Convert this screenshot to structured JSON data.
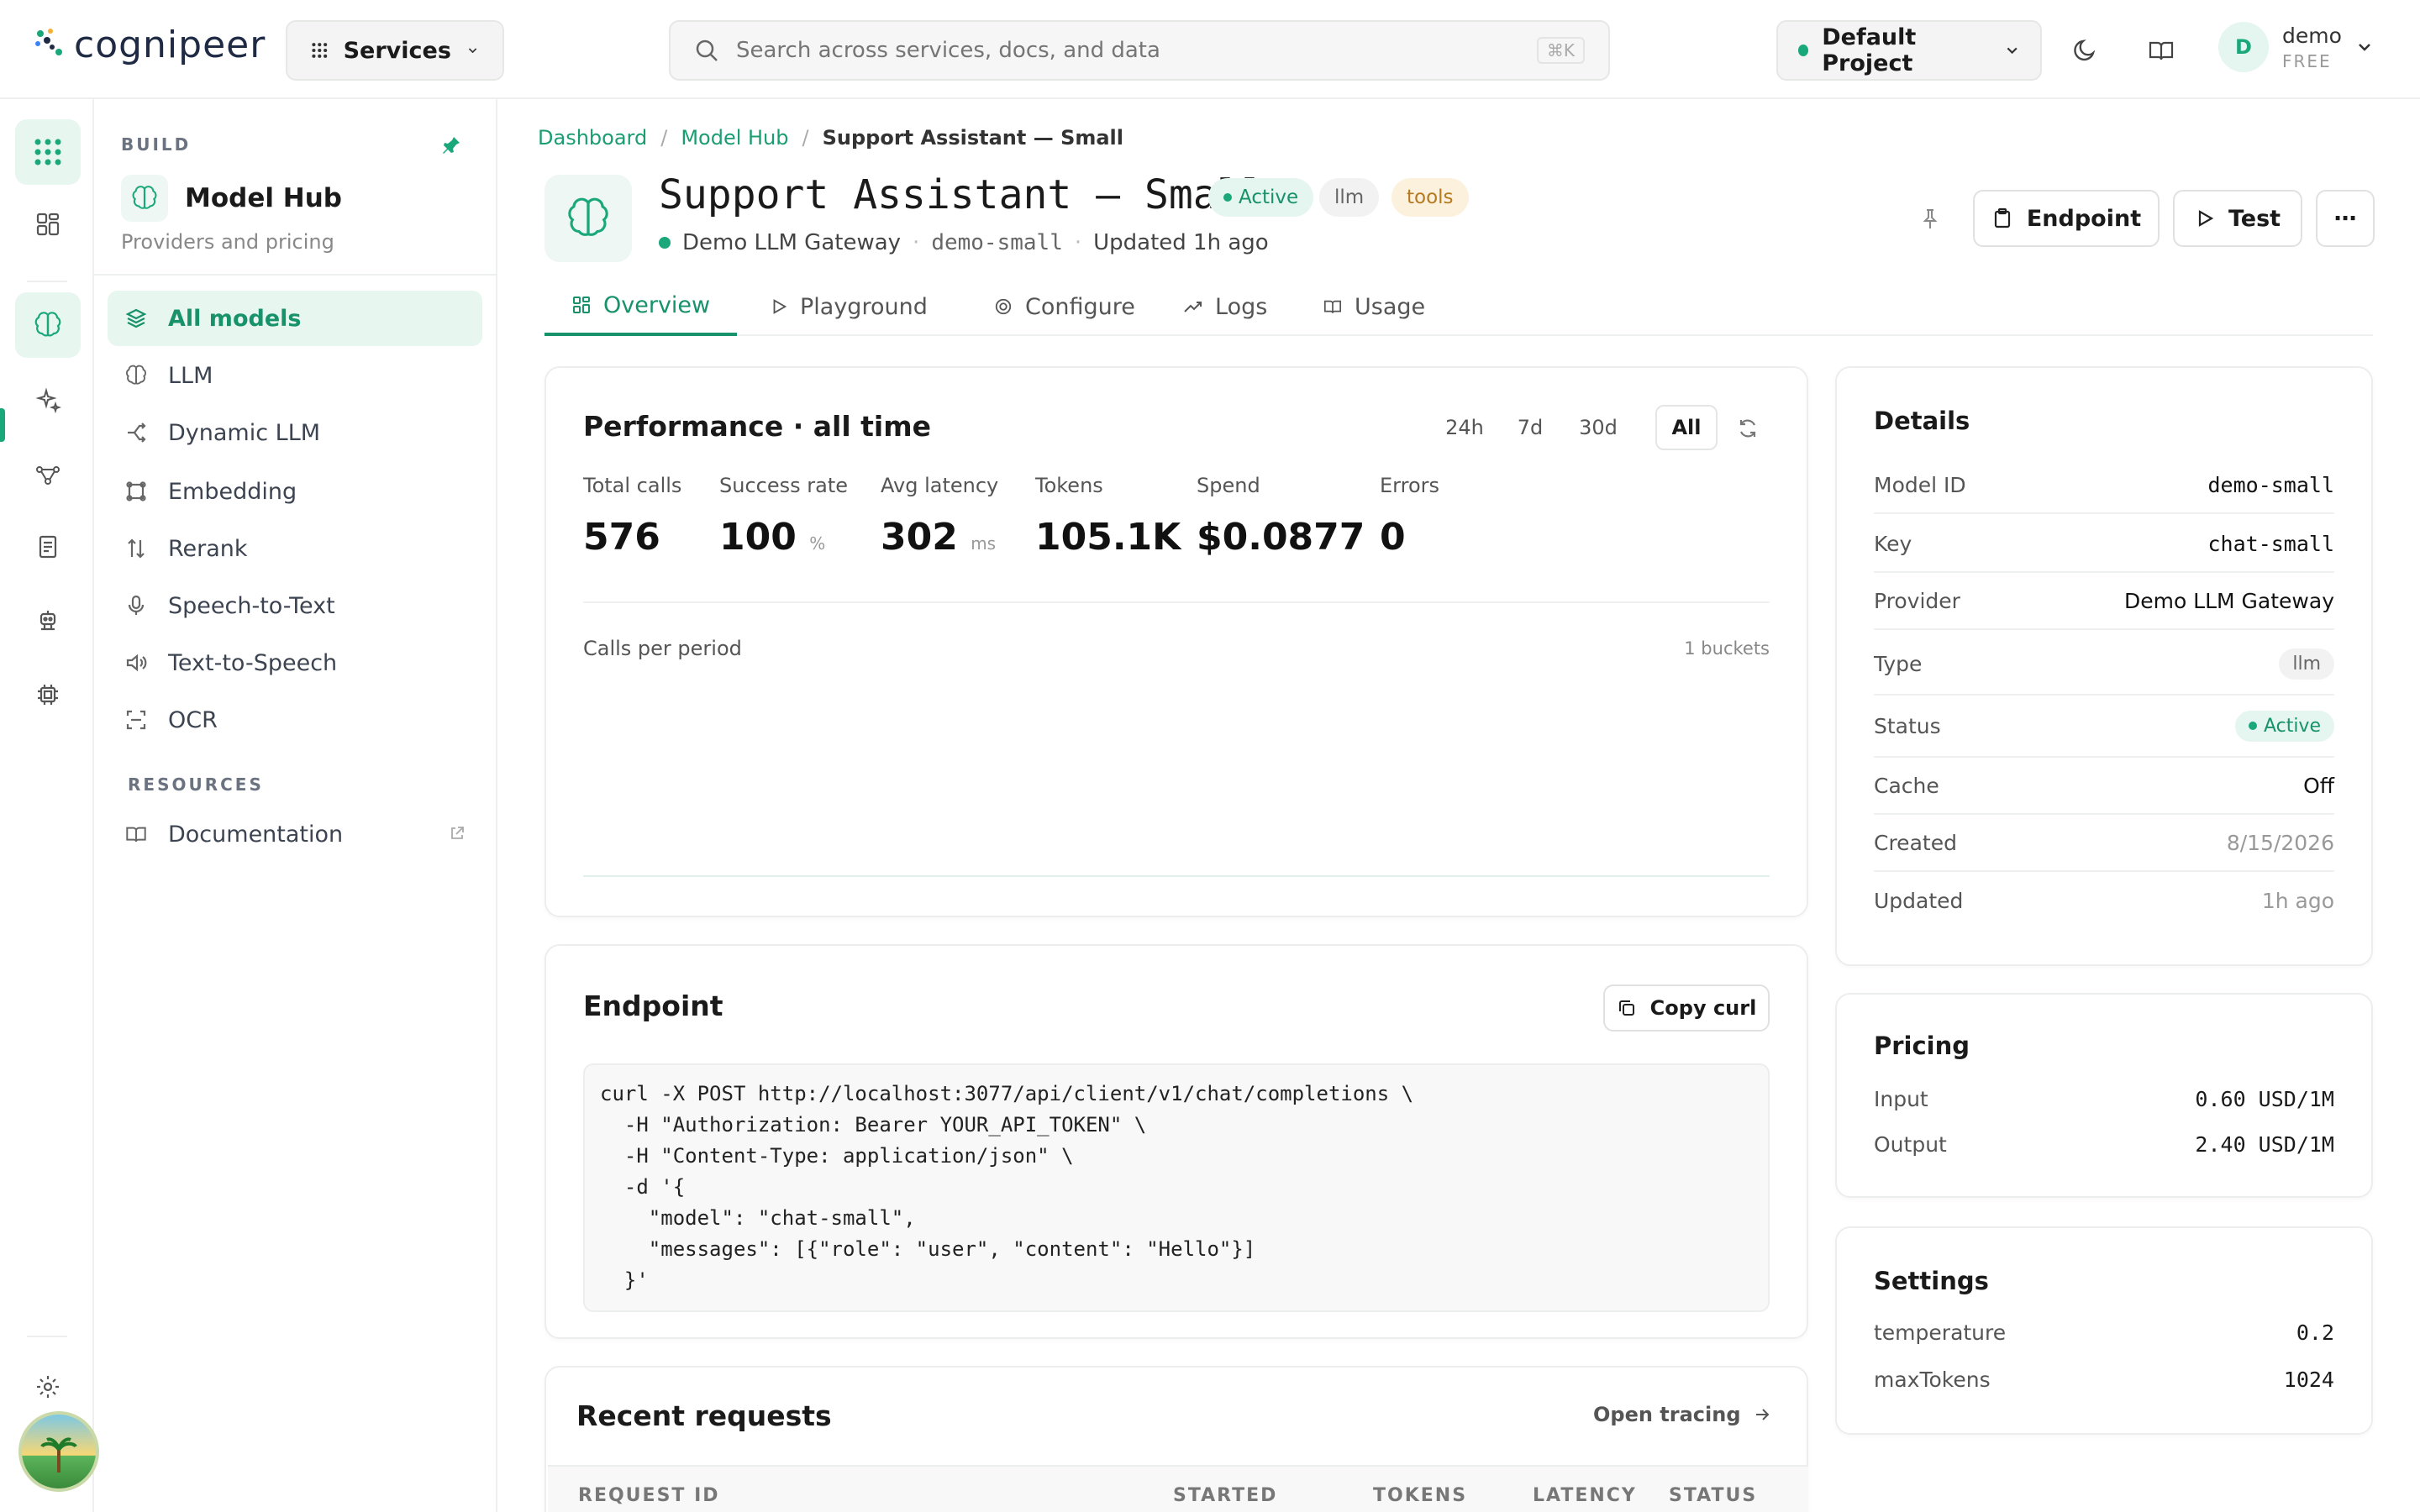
{
  "brand": {
    "name": "cognipeer"
  },
  "topbar": {
    "services_label": "Services",
    "search_placeholder": "Search across services, docs, and data",
    "search_shortcut": "⌘K",
    "project_label": "Default Project",
    "user": {
      "initial": "D",
      "name": "demo",
      "plan": "FREE"
    }
  },
  "sidebar": {
    "section": "BUILD",
    "title": "Model Hub",
    "subtitle": "Providers and pricing",
    "items": [
      {
        "label": "All models",
        "icon": "layers-icon"
      },
      {
        "label": "LLM",
        "icon": "brain-icon"
      },
      {
        "label": "Dynamic LLM",
        "icon": "split-icon"
      },
      {
        "label": "Embedding",
        "icon": "embedding-icon"
      },
      {
        "label": "Rerank",
        "icon": "sort-icon"
      },
      {
        "label": "Speech-to-Text",
        "icon": "mic-icon"
      },
      {
        "label": "Text-to-Speech",
        "icon": "speaker-icon"
      },
      {
        "label": "OCR",
        "icon": "scan-icon"
      }
    ],
    "resources_section": "RESOURCES",
    "resources": [
      {
        "label": "Documentation",
        "icon": "book-icon"
      }
    ]
  },
  "breadcrumb": [
    "Dashboard",
    "Model Hub",
    "Support Assistant — Small"
  ],
  "model": {
    "title": "Support Assistant — Small",
    "status": "Active",
    "type_tag": "llm",
    "tools_tag": "tools",
    "provider": "Demo LLM Gateway",
    "slug": "demo-small",
    "updated": "Updated 1h ago"
  },
  "actions": {
    "endpoint": "Endpoint",
    "test": "Test",
    "more": "⋯"
  },
  "tabs": [
    "Overview",
    "Playground",
    "Configure",
    "Logs",
    "Usage"
  ],
  "performance": {
    "title": "Performance · all time",
    "ranges": [
      "24h",
      "7d",
      "30d",
      "All"
    ],
    "active_range": "All",
    "stats": [
      {
        "label": "Total calls",
        "value": "576",
        "unit": ""
      },
      {
        "label": "Success rate",
        "value": "100",
        "unit": "%"
      },
      {
        "label": "Avg latency",
        "value": "302",
        "unit": "ms"
      },
      {
        "label": "Tokens",
        "value": "105.1K",
        "unit": ""
      },
      {
        "label": "Spend",
        "value": "$0.0877",
        "unit": ""
      },
      {
        "label": "Errors",
        "value": "0",
        "unit": ""
      }
    ],
    "chart_label": "Calls per period",
    "buckets_label": "1 buckets"
  },
  "endpoint": {
    "title": "Endpoint",
    "copy_label": "Copy curl",
    "code": "curl -X POST http://localhost:3077/api/client/v1/chat/completions \\\n  -H \"Authorization: Bearer YOUR_API_TOKEN\" \\\n  -H \"Content-Type: application/json\" \\\n  -d '{\n    \"model\": \"chat-small\",\n    \"messages\": [{\"role\": \"user\", \"content\": \"Hello\"}]\n  }'"
  },
  "recent": {
    "title": "Recent requests",
    "open_tracing": "Open tracing",
    "columns": [
      "REQUEST ID",
      "STARTED",
      "TOKENS",
      "LATENCY",
      "STATUS"
    ]
  },
  "details": {
    "title": "Details",
    "rows": [
      {
        "key": "Model ID",
        "value": "demo-small"
      },
      {
        "key": "Key",
        "value": "chat-small"
      },
      {
        "key": "Provider",
        "value": "Demo LLM Gateway"
      },
      {
        "key": "Type",
        "value": "llm"
      },
      {
        "key": "Status",
        "value": "Active"
      },
      {
        "key": "Cache",
        "value": "Off"
      },
      {
        "key": "Created",
        "value": "8/15/2026"
      },
      {
        "key": "Updated",
        "value": "1h ago"
      }
    ]
  },
  "pricing": {
    "title": "Pricing",
    "rows": [
      {
        "key": "Input",
        "value": "0.60 USD/1M"
      },
      {
        "key": "Output",
        "value": "2.40 USD/1M"
      }
    ]
  },
  "settings": {
    "title": "Settings",
    "rows": [
      {
        "key": "temperature",
        "value": "0.2"
      },
      {
        "key": "maxTokens",
        "value": "1024"
      }
    ]
  },
  "colors": {
    "accent": "#1aa77a",
    "tools_badge_bg": "#fbf1dc",
    "tools_badge_fg": "#b7791f"
  }
}
